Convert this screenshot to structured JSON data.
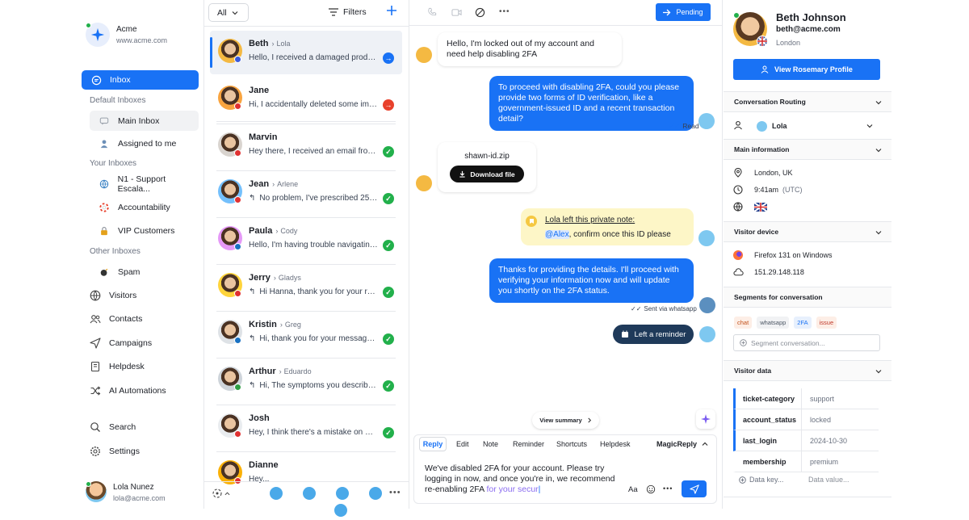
{
  "workspace": {
    "name": "Acme",
    "url": "www.acme.com"
  },
  "sidebar": {
    "inbox": "Inbox",
    "default_inboxes_label": "Default Inboxes",
    "main_inbox": "Main Inbox",
    "assigned_to_me": "Assigned to me",
    "your_inboxes_label": "Your Inboxes",
    "your_inboxes": [
      "N1 - Support Escala...",
      "Accountability",
      "VIP Customers"
    ],
    "other_inboxes_label": "Other Inboxes",
    "spam": "Spam",
    "nav": [
      "Visitors",
      "Contacts",
      "Campaigns",
      "Helpdesk",
      "AI Automations"
    ],
    "search": "Search",
    "settings": "Settings",
    "user": {
      "name": "Lola Nunez",
      "email": "lola@acme.com"
    }
  },
  "list_header": {
    "filter_all": "All",
    "filters": "Filters"
  },
  "conversations": [
    {
      "name": "Beth",
      "assignee": "Lola",
      "preview": "Hello, I received a damaged product...",
      "status": "arrow",
      "reply": false,
      "avatar_color": "#f4b942",
      "flag": "#3b5bdb"
    },
    {
      "name": "Jane",
      "assignee": "",
      "preview": "Hi, I accidentally deleted some imp...",
      "status": "urgent",
      "reply": false,
      "avatar_color": "#f9a43f",
      "flag": "#e03131"
    },
    {
      "name": "Marvin",
      "assignee": "",
      "preview": "Hey there, I received an email from...",
      "status": "done",
      "reply": false,
      "avatar_color": "#d9d4cf",
      "flag": "#e03131"
    },
    {
      "name": "Jean",
      "assignee": "Arlene",
      "preview": "No problem, I've prescribed 25mg...",
      "status": "done",
      "reply": true,
      "avatar_color": "#74c0fc",
      "flag": "#e03131"
    },
    {
      "name": "Paula",
      "assignee": "Cody",
      "preview": "Hello, I'm having trouble navigating t...",
      "status": "done",
      "reply": false,
      "avatar_color": "#e599f7",
      "flag": "#1971c2"
    },
    {
      "name": "Jerry",
      "assignee": "Gladys",
      "preview": "Hi Hanna, thank you for your rea...",
      "status": "done",
      "reply": true,
      "avatar_color": "#ffd43b",
      "flag": "#e03131"
    },
    {
      "name": "Kristin",
      "assignee": "Greg",
      "preview": "Hi, thank you for your message....",
      "status": "done",
      "reply": true,
      "avatar_color": "#dee2e6",
      "flag": "#1971c2"
    },
    {
      "name": "Arthur",
      "assignee": "Eduardo",
      "preview": "Hi, The symptoms you describe s...",
      "status": "done",
      "reply": true,
      "avatar_color": "#ced4da",
      "flag": "#2f9e44"
    },
    {
      "name": "Josh",
      "assignee": "",
      "preview": "Hey, I think there's a mistake on my...",
      "status": "done",
      "reply": false,
      "avatar_color": "#e9ecef",
      "flag": "#e03131"
    },
    {
      "name": "Dianne",
      "assignee": "",
      "preview": "Hey...",
      "status": "none",
      "reply": false,
      "avatar_color": "#fab005",
      "flag": "#e03131"
    }
  ],
  "chat": {
    "status_button": "Pending",
    "msg1": "Hello, I'm locked out of my account and need help disabling 2FA",
    "msg2": "To proceed with disabling 2FA, could you please provide two forms of ID verification, like a government-issued ID and a recent transaction detail?",
    "read": "Read",
    "file_name": "shawn-id.zip",
    "download": "Download file",
    "note_title": "Lola left this private note:",
    "note_mention": "@Alex",
    "note_text": ", confirm once this ID please",
    "msg3": "Thanks for providing the details. I'll proceed with verifying your information now and will update you shortly on the 2FA status.",
    "sent_via": "Sent via whatsapp",
    "reminder": "Left a reminder",
    "view_summary": "View summary"
  },
  "composer": {
    "tabs": [
      "Reply",
      "Edit",
      "Note",
      "Reminder",
      "Shortcuts",
      "Helpdesk"
    ],
    "magic": "MagicReply",
    "text": "We've disabled 2FA for your account. Please try logging in now, and once you're in, we recommend re-enabling 2FA",
    "text_suggest": " for your secur",
    "aa": "Aa"
  },
  "profile": {
    "name": "Beth Johnson",
    "email": "beth@acme.com",
    "location": "London",
    "view_profile": "View Rosemary Profile",
    "routing_label": "Conversation Routing",
    "routing_agent": "Lola",
    "main_info_label": "Main information",
    "city": "London, UK",
    "time": "9:41am",
    "tz": "(UTC)",
    "device_label": "Visitor device",
    "browser": "Firefox 131 on Windows",
    "ip": "151.29.148.118",
    "segments_label": "Segments for conversation",
    "segments": [
      "chat",
      "whatsapp",
      "2FA",
      "issue"
    ],
    "segment_placeholder": "Segment conversation...",
    "visitor_data_label": "Visitor data",
    "visitor_data": [
      {
        "key": "ticket-category",
        "value": "support"
      },
      {
        "key": "account_status",
        "value": "locked"
      },
      {
        "key": "last_login",
        "value": "2024-10-30"
      },
      {
        "key": "membership",
        "value": "premium"
      }
    ],
    "data_key_placeholder": "Data key...",
    "data_value_placeholder": "Data value..."
  },
  "colors": {
    "primary": "#1972f5",
    "done": "#22b04b",
    "urgent": "#e8412c",
    "note_bg": "#fdf6c7"
  }
}
